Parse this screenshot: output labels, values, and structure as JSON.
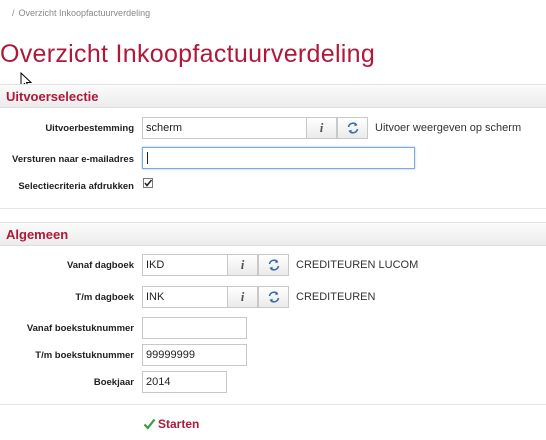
{
  "breadcrumb": {
    "separator": "/",
    "current": "Overzicht Inkoopfactuurverdeling"
  },
  "page": {
    "title": "Overzicht Inkoopfactuurverdeling"
  },
  "sections": {
    "uitvoer": {
      "title": "Uitvoerselectie",
      "uitvoerbestemming": {
        "label": "Uitvoerbestemming",
        "value": "scherm",
        "description": "Uitvoer weergeven op scherm"
      },
      "email": {
        "label": "Versturen naar e-mailadres",
        "value": ""
      },
      "afdrukken": {
        "label": "Selectiecriteria afdrukken",
        "checked": true
      }
    },
    "algemeen": {
      "title": "Algemeen",
      "vanaf_dagboek": {
        "label": "Vanaf dagboek",
        "value": "IKD",
        "description": "CREDITEUREN LUCOM"
      },
      "tm_dagboek": {
        "label": "T/m dagboek",
        "value": "INK",
        "description": "CREDITEUREN"
      },
      "vanaf_boekstuk": {
        "label": "Vanaf boekstuknummer",
        "value": ""
      },
      "tm_boekstuk": {
        "label": "T/m boekstuknummer",
        "value": "99999999"
      },
      "boekjaar": {
        "label": "Boekjaar",
        "value": "2014"
      }
    }
  },
  "actions": {
    "start_label": "Starten"
  },
  "colors": {
    "accent": "#b0183a",
    "check": "#3a9a3a"
  }
}
